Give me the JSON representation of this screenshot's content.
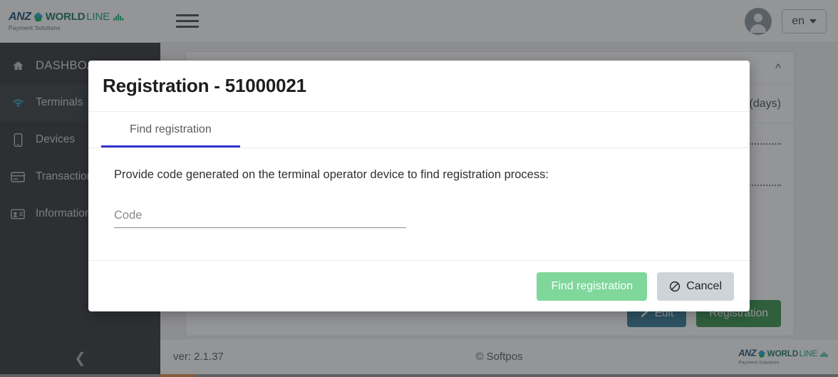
{
  "brand": {
    "name_anz": "ANZ",
    "name_worldline": "WORLD",
    "name_line": "LINE",
    "tagline": "Payment Solutions"
  },
  "topbar": {
    "menu_icon": "hamburger-icon",
    "avatar_icon": "user-avatar-icon",
    "language": "en"
  },
  "sidebar": {
    "items": [
      {
        "label": "DASHBOARD",
        "icon": "home-icon"
      },
      {
        "label": "Terminals",
        "icon": "wifi-icon"
      },
      {
        "label": "Devices",
        "icon": "mobile-icon"
      },
      {
        "label": "Transactions",
        "icon": "credit-card-icon"
      },
      {
        "label": "Information",
        "icon": "id-card-icon"
      }
    ],
    "collapse_icon": "chevron-left-icon"
  },
  "content": {
    "collapse_icon": "chevron-up-icon",
    "row_text": "(days)",
    "edit_label": "Edit",
    "edit_icon": "pencil-icon",
    "registration_label": "Registration"
  },
  "modal": {
    "title": "Registration - 51000021",
    "tabs": [
      {
        "label": "Find registration",
        "active": true
      }
    ],
    "instruction": "Provide code generated on the terminal operator device to find registration process:",
    "code_field": {
      "label": "Code",
      "placeholder": "Code",
      "value": ""
    },
    "find_label": "Find registration",
    "cancel_label": "Cancel",
    "cancel_icon": "ban-icon",
    "accent_tab": "#3333cc",
    "find_button_color": "#7fd79b",
    "cancel_button_color": "#ced4da"
  },
  "footer": {
    "version": "ver: 2.1.37",
    "copyright": "© Softpos"
  }
}
